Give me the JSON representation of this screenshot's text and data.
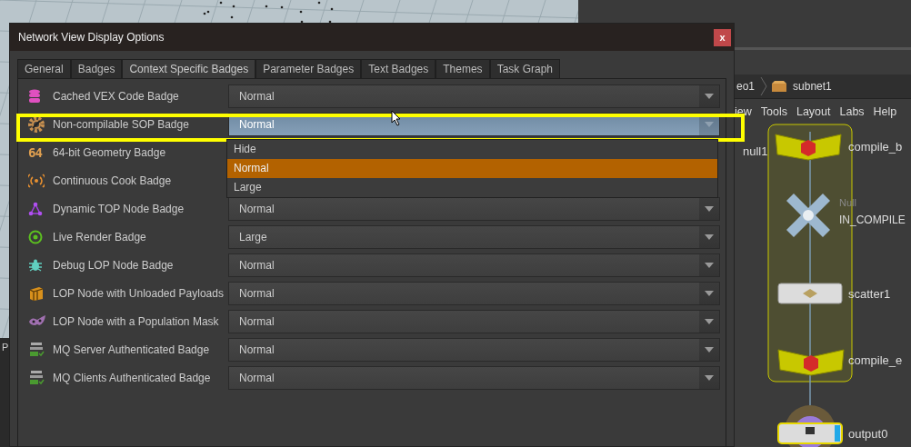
{
  "background": {
    "left_pane_label": "P",
    "breadcrumb": [
      "eo1",
      "subnet1"
    ],
    "menu": [
      "iew",
      "Tools",
      "Layout",
      "Labs",
      "Help"
    ],
    "nodes": [
      {
        "kind": "null_off",
        "name": "null1"
      },
      {
        "kind": "compile",
        "name": "compile_b"
      },
      {
        "kind": "null",
        "name": "IN_COMPILE",
        "type_label": "Null"
      },
      {
        "kind": "scatter",
        "name": "scatter1"
      },
      {
        "kind": "compile",
        "name": "compile_e"
      },
      {
        "kind": "output",
        "name": "output0"
      }
    ]
  },
  "dialog": {
    "title": "Network View Display Options",
    "close_label": "x",
    "tabs": [
      {
        "label": "General",
        "selected": false
      },
      {
        "label": "Badges",
        "selected": false
      },
      {
        "label": "Context Specific Badges",
        "selected": true
      },
      {
        "label": "Parameter Badges",
        "selected": false
      },
      {
        "label": "Text Badges",
        "selected": false
      },
      {
        "label": "Themes",
        "selected": false
      },
      {
        "label": "Task Graph",
        "selected": false
      }
    ],
    "rows": [
      {
        "kind": "database",
        "label": "Cached VEX Code Badge",
        "value": "Normal"
      },
      {
        "kind": "gear",
        "label": "Non-compilable SOP Badge",
        "value": "Normal",
        "highlighted": true,
        "open": true,
        "options": [
          {
            "label": "Hide",
            "selected": false
          },
          {
            "label": "Normal",
            "selected": true
          },
          {
            "label": "Large",
            "selected": false
          }
        ]
      },
      {
        "kind": "text",
        "icon_text": "64",
        "label": "64-bit Geometry Badge"
      },
      {
        "kind": "signal",
        "label": "Continuous Cook Badge"
      },
      {
        "kind": "graph",
        "label": "Dynamic TOP Node Badge",
        "value": "Normal"
      },
      {
        "kind": "target",
        "label": "Live Render Badge",
        "value": "Large"
      },
      {
        "kind": "bug",
        "label": "Debug LOP Node Badge",
        "value": "Normal"
      },
      {
        "kind": "box",
        "label": "LOP Node with Unloaded Payloads",
        "value": "Normal"
      },
      {
        "kind": "mask",
        "label": "LOP Node with a Population Mask",
        "value": "Normal"
      },
      {
        "kind": "mq",
        "label": "MQ Server Authenticated Badge",
        "value": "Normal"
      },
      {
        "kind": "mq",
        "label": "MQ Clients Authenticated Badge",
        "value": "Normal"
      }
    ]
  }
}
